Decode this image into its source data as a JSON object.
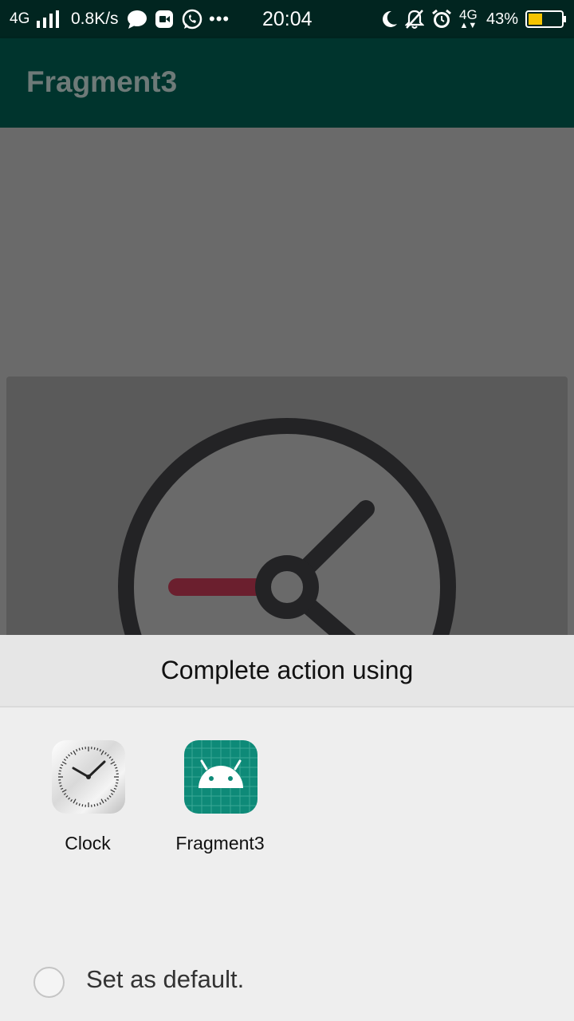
{
  "status_bar": {
    "network": "4G",
    "speed": "0.8K/s",
    "time": "20:04",
    "network_right": "4G",
    "battery": "43%",
    "icons": [
      "signal-bars-icon",
      "chat-bubble-icon",
      "video-call-icon",
      "whatsapp-icon",
      "more-dots-icon",
      "moon-icon",
      "bell-mute-icon",
      "alarm-icon",
      "data-arrows-icon",
      "battery-icon"
    ],
    "battery_level": 0.43,
    "battery_color": "#f5c400"
  },
  "app_bar": {
    "title": "Fragment3",
    "background": "#00342d"
  },
  "content": {
    "clock_illustration": "clock-icon",
    "hour_hand_color": "#6b1f2e"
  },
  "chooser": {
    "title": "Complete action using",
    "apps": [
      {
        "label": "Clock",
        "icon": "clock-app-icon"
      },
      {
        "label": "Fragment3",
        "icon": "android-app-icon"
      }
    ],
    "default_label": "Set as default.",
    "default_checked": false
  }
}
